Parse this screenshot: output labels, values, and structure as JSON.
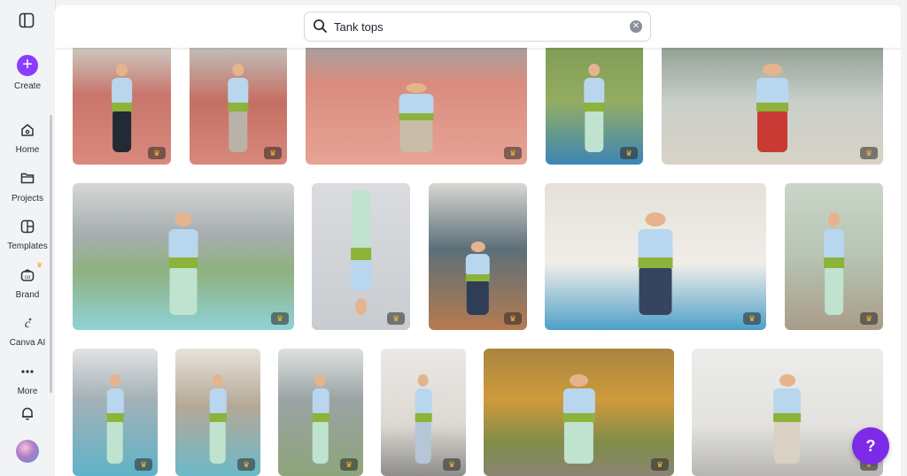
{
  "rail": {
    "create_label": "Create",
    "items": [
      {
        "label": "Home",
        "icon": "home-icon"
      },
      {
        "label": "Projects",
        "icon": "folder-icon"
      },
      {
        "label": "Templates",
        "icon": "templates-icon"
      },
      {
        "label": "Brand",
        "icon": "brand-icon"
      },
      {
        "label": "Canva AI",
        "icon": "canva-ai-icon"
      },
      {
        "label": "More",
        "icon": "more-icon"
      }
    ]
  },
  "search": {
    "value": "Tank tops"
  },
  "help": {
    "label": "?"
  },
  "colors": {
    "accent": "#8b3dff",
    "help": "#7d2ae8",
    "crown": "#f7b733"
  },
  "photos": [
    {
      "scene": "track-leg-prosthetic-standing"
    },
    {
      "scene": "track-leg-prosthetic-walking"
    },
    {
      "scene": "track-side-plank"
    },
    {
      "scene": "park-lunge-mat"
    },
    {
      "scene": "courtyard-kneeling-stretch"
    },
    {
      "scene": "poolside-tree-pose"
    },
    {
      "scene": "studio-headstand"
    },
    {
      "scene": "deck-side-plank"
    },
    {
      "scene": "patio-side-plank"
    },
    {
      "scene": "steps-seated-block"
    },
    {
      "scene": "pool-prayer-pose"
    },
    {
      "scene": "pool-lotus"
    },
    {
      "scene": "courtyard-seated-meditation"
    },
    {
      "scene": "studio-side-plank"
    },
    {
      "scene": "forest-seated-wide"
    },
    {
      "scene": "studio-pair-stretch"
    }
  ]
}
